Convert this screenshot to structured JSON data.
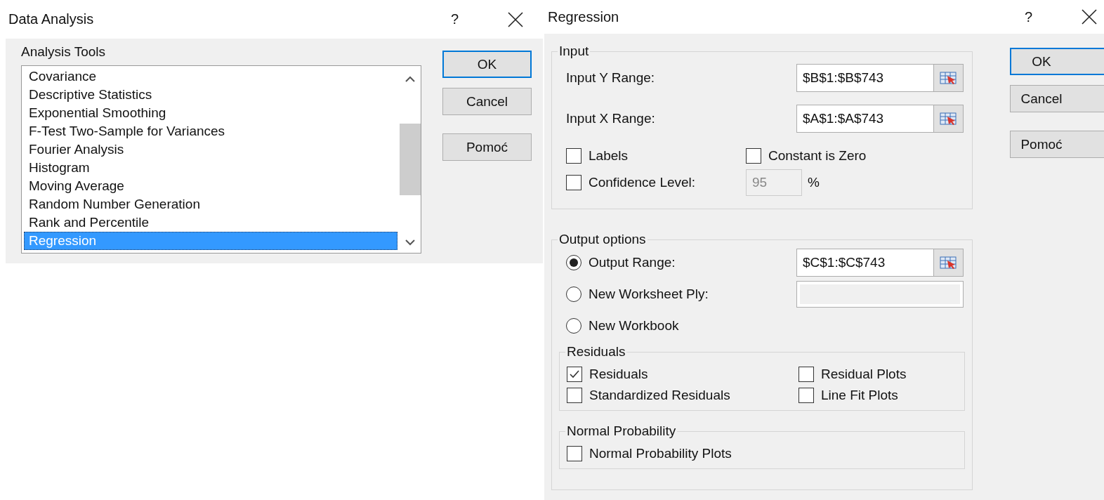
{
  "data_analysis": {
    "title": "Data Analysis",
    "help": "?",
    "list_label": "Analysis Tools",
    "items": [
      {
        "label": "Covariance",
        "selected": false
      },
      {
        "label": "Descriptive Statistics",
        "selected": false
      },
      {
        "label": "Exponential Smoothing",
        "selected": false
      },
      {
        "label": "F-Test Two-Sample for Variances",
        "selected": false
      },
      {
        "label": "Fourier Analysis",
        "selected": false
      },
      {
        "label": "Histogram",
        "selected": false
      },
      {
        "label": "Moving Average",
        "selected": false
      },
      {
        "label": "Random Number Generation",
        "selected": false
      },
      {
        "label": "Rank and Percentile",
        "selected": false
      },
      {
        "label": "Regression",
        "selected": true
      }
    ],
    "buttons": [
      {
        "label": "OK",
        "default": true
      },
      {
        "label": "Cancel",
        "default": false
      },
      {
        "label": "Pomoć",
        "default": false
      }
    ]
  },
  "regression": {
    "title": "Regression",
    "help": "?",
    "input": {
      "legend": "Input",
      "fields": [
        {
          "label": "Input Y Range:",
          "value": "$B$1:$B$743"
        },
        {
          "label": "Input X Range:",
          "value": "$A$1:$A$743"
        }
      ],
      "checks": [
        {
          "label": "Labels",
          "checked": false
        },
        {
          "label": "Constant is Zero",
          "checked": false
        }
      ],
      "confidence": {
        "label": "Confidence Level:",
        "checked": false,
        "value": "95",
        "disabled": true,
        "unit": "%"
      }
    },
    "output": {
      "legend": "Output options",
      "options": [
        {
          "label": "Output Range:",
          "selected": true,
          "kind": "range",
          "value": "$C$1:$C$743"
        },
        {
          "label": "New Worksheet Ply:",
          "selected": false,
          "kind": "text"
        },
        {
          "label": "New Workbook",
          "selected": false,
          "kind": "none"
        }
      ],
      "residuals": {
        "legend": "Residuals",
        "checks": [
          {
            "label": "Residuals",
            "checked": true
          },
          {
            "label": "Residual Plots",
            "checked": false
          },
          {
            "label": "Standardized Residuals",
            "checked": false
          },
          {
            "label": "Line Fit Plots",
            "checked": false
          }
        ]
      },
      "normal": {
        "legend": "Normal Probability",
        "checks": [
          {
            "label": "Normal Probability Plots",
            "checked": false
          }
        ]
      }
    },
    "buttons": [
      {
        "label": "OK",
        "default": true
      },
      {
        "label": "Cancel",
        "default": false
      },
      {
        "label": "Pomoć",
        "default": false
      }
    ]
  }
}
